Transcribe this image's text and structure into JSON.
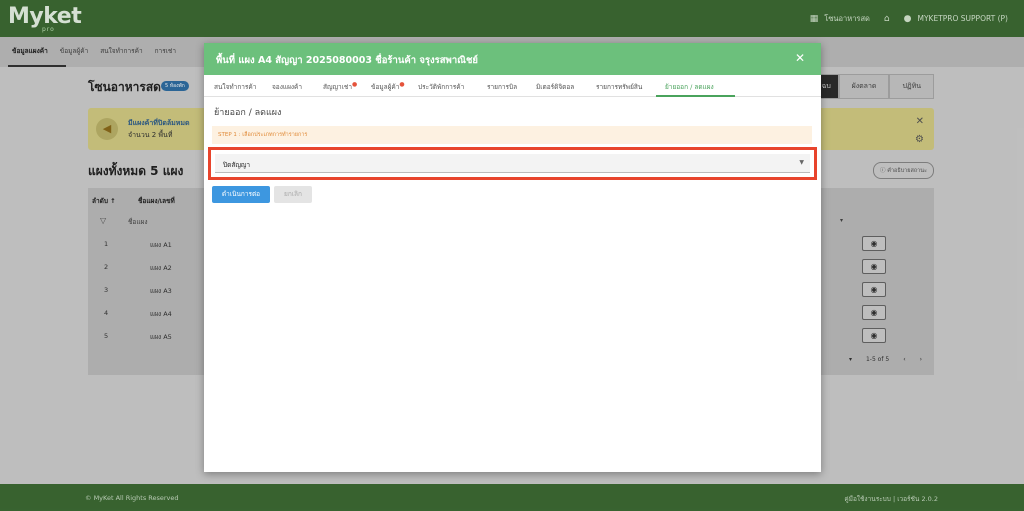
{
  "app": {
    "logo": "Myket",
    "logo_sub": "pro",
    "shop_label": "โซนอาหารสด",
    "user_label": "MYKETPRO SUPPORT (P)"
  },
  "subnav": {
    "tabs": [
      "ข้อมูลแผงค้า",
      "ข้อมูลผู้ค้า",
      "สนใจทำการค้า",
      "การเช่า"
    ]
  },
  "page": {
    "title": "โซนอาหารสด",
    "badge": "5 ห้องพัก",
    "right_tabs": [
      "",
      "ผังตลาด",
      "ปฏิทิน"
    ],
    "rt_first_label": "ฉบ"
  },
  "alert": {
    "line1": "มีแผงค้าที่ปิดล้มหมด",
    "line2": "จำนวน 2 พื้นที่"
  },
  "section": {
    "title": "แผงทั้งหมด 5 แผง",
    "help": "คำอธิบายสถานะ"
  },
  "table": {
    "headers": [
      "ลำดับ",
      "ชื่อแผง/เลขที่"
    ],
    "filter_placeholder": "ชื่อแผง",
    "rows": [
      {
        "num": "1",
        "name": "แผง A1"
      },
      {
        "num": "2",
        "name": "แผง A2"
      },
      {
        "num": "3",
        "name": "แผง A3"
      },
      {
        "num": "4",
        "name": "แผง A4"
      },
      {
        "num": "5",
        "name": "แผง A5"
      }
    ],
    "pager": "1-5 of 5"
  },
  "footer": {
    "left": "© MyKet All Rights Reserved",
    "right": "คู่มือใช้งานระบบ | เวอร์ชัน 2.0.2"
  },
  "modal": {
    "title": "พื้นที่ แผง A4 สัญญา 2025080003 ชื่อร้านค้า จรุงรสพาณิชย์",
    "tabs": [
      {
        "label": "สนใจทำการค้า",
        "dot": false,
        "active": false
      },
      {
        "label": "จองแผงค้า",
        "dot": false,
        "active": false
      },
      {
        "label": "สัญญาเช่า",
        "dot": true,
        "active": false
      },
      {
        "label": "ข้อมูลผู้ค้า",
        "dot": true,
        "active": false
      },
      {
        "label": "ประวัติพักการค้า",
        "dot": false,
        "active": false
      },
      {
        "label": "รายการบิล",
        "dot": false,
        "active": false
      },
      {
        "label": "มิเตอร์ดิจิตอล",
        "dot": false,
        "active": false
      },
      {
        "label": "รายการทรัพย์สิน",
        "dot": false,
        "active": false
      },
      {
        "label": "ย้ายออก / ลดแผง",
        "dot": false,
        "active": true
      }
    ],
    "subtitle": "ย้ายออก / ลดแผง",
    "step_text": "STEP 1 : เลือกประเภทการทำรายการ",
    "select_value": "ปิดสัญญา",
    "primary_button": "ดำเนินการต่อ",
    "cancel_button": "ยกเลิก"
  },
  "colors": {
    "header_green": "#6cc07c",
    "topbar_green": "#3d6b34",
    "highlight_red": "#e8442c",
    "primary_blue": "#3d97e0"
  }
}
